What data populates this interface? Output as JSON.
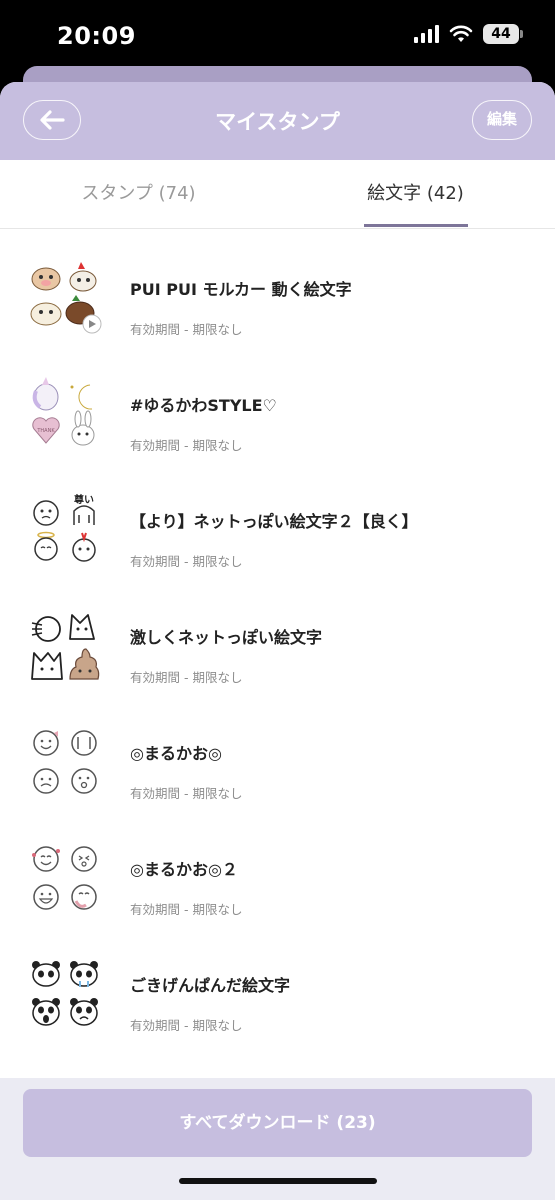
{
  "status_bar": {
    "time": "20:09",
    "battery": "44"
  },
  "header": {
    "title": "マイスタンプ",
    "edit_label": "編集"
  },
  "tabs": [
    {
      "label": "スタンプ (74)",
      "active": false
    },
    {
      "label": "絵文字 (42)",
      "active": true
    }
  ],
  "items": [
    {
      "title": "PUI PUI モルカー 動く絵文字",
      "subtitle": "有効期間 - 期限なし"
    },
    {
      "title": "#ゆるかわSTYLE♡",
      "subtitle": "有効期間 - 期限なし"
    },
    {
      "title": "【より】ネットっぽい絵文字２【良く】",
      "subtitle": "有効期間 - 期限なし"
    },
    {
      "title": "激しくネットっぽい絵文字",
      "subtitle": "有効期間 - 期限なし"
    },
    {
      "title": "◎まるかお◎",
      "subtitle": "有効期間 - 期限なし"
    },
    {
      "title": "◎まるかお◎２",
      "subtitle": "有効期間 - 期限なし"
    },
    {
      "title": "ごきげんぱんだ絵文字",
      "subtitle": "有効期間 - 期限なし"
    }
  ],
  "footer": {
    "download_all_label": "すべてダウンロード (23)"
  },
  "colors": {
    "header_bg": "#c6bedf",
    "accent_underline": "#7d7599",
    "footer_bg": "#ebebf3"
  },
  "icons": {
    "back": "arrow-left-icon",
    "thumbnails": [
      "molcar-emoji-icon",
      "yurukawa-emoji-icon",
      "net-emoji-2-icon",
      "net-emoji-icon",
      "marukao-emoji-icon",
      "marukao-2-emoji-icon",
      "panda-emoji-icon"
    ]
  }
}
